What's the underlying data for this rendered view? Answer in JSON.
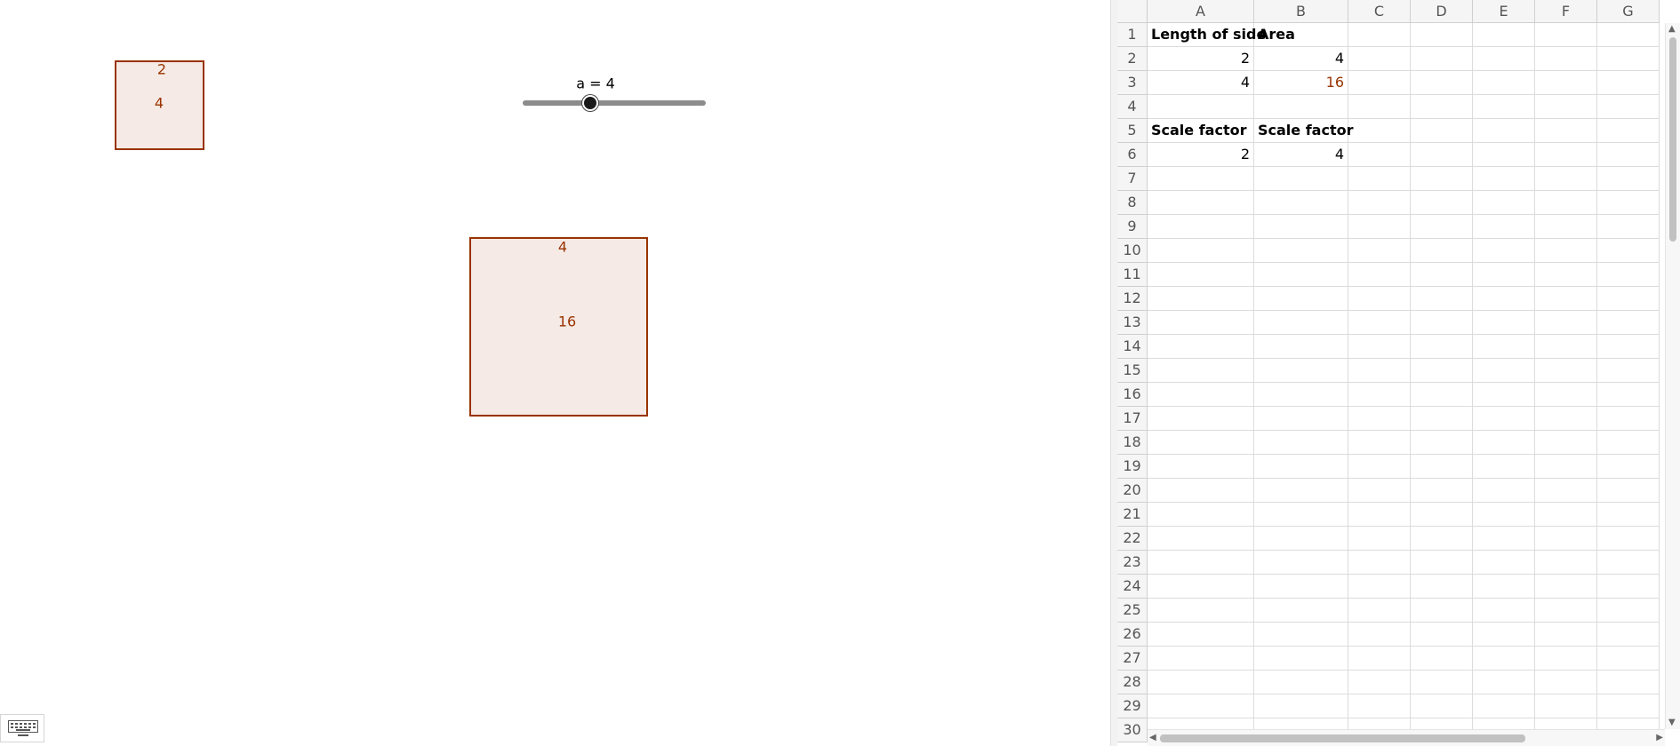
{
  "graphics": {
    "small_square": {
      "side_label": "2",
      "area_label": "4"
    },
    "large_square": {
      "side_label": "4",
      "area_label": "16"
    },
    "slider": {
      "label": "a = 4",
      "value": 4
    },
    "keyboard_icon": "keyboard-icon",
    "colors": {
      "object": "#993300",
      "fill": "rgba(153,51,0,0.10)"
    }
  },
  "spreadsheet": {
    "columns": [
      "A",
      "B",
      "C",
      "D",
      "E",
      "F",
      "G"
    ],
    "rows": [
      "1",
      "2",
      "3",
      "4",
      "5",
      "6",
      "7",
      "8",
      "9",
      "10",
      "11",
      "12",
      "13",
      "14",
      "15",
      "16",
      "17",
      "18",
      "19",
      "20",
      "21",
      "22",
      "23",
      "24",
      "25",
      "26",
      "27",
      "28",
      "29",
      "30"
    ],
    "cells": {
      "A1": "Length of side",
      "B1": "Area",
      "A2": "2",
      "B2": "4",
      "A3": "4",
      "B3": "16",
      "A5": "Scale factor",
      "B5": "Scale factor",
      "A6": "2",
      "B6": "4"
    }
  }
}
